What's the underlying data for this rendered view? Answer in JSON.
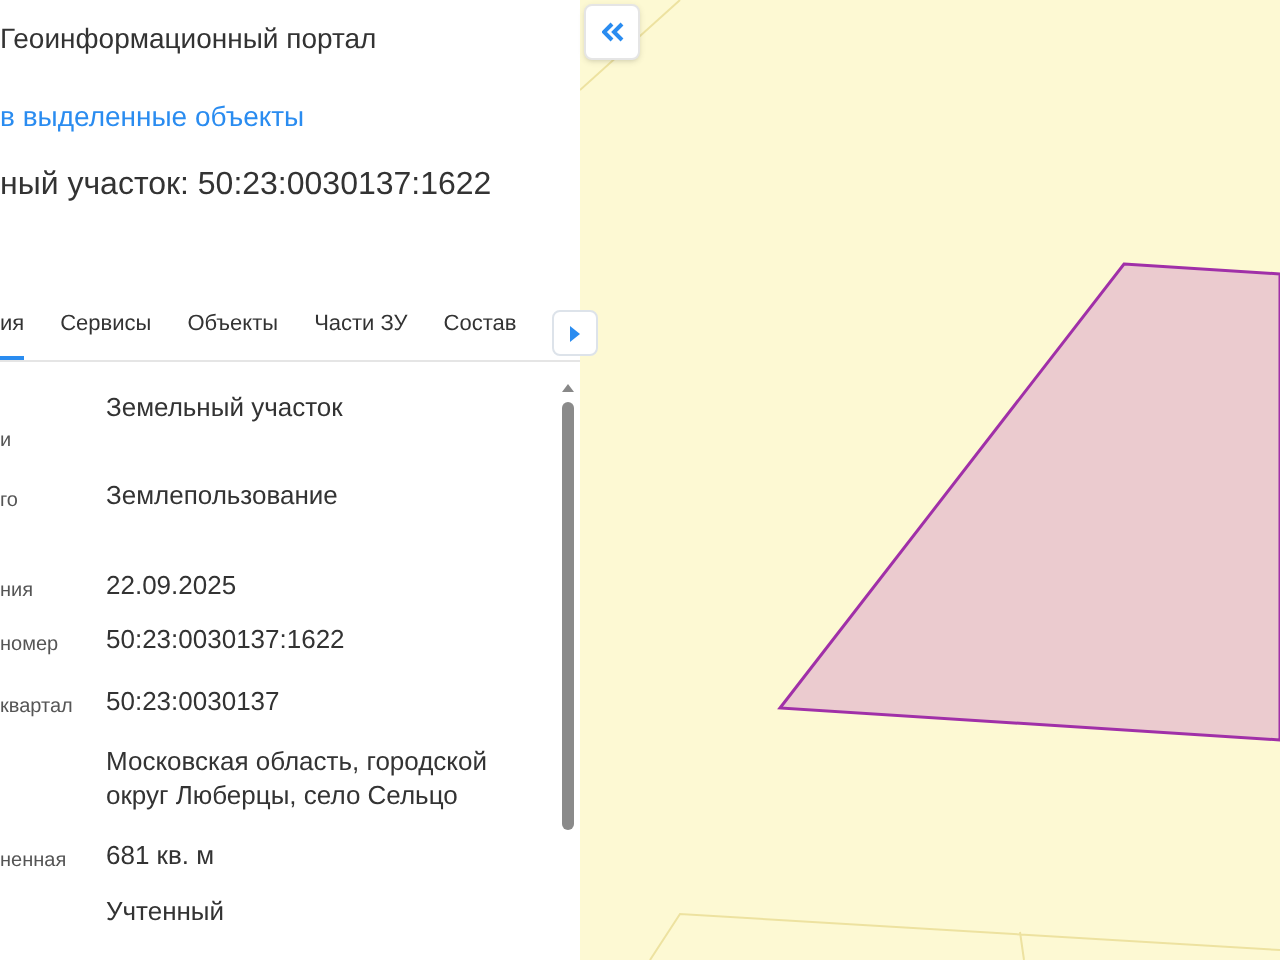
{
  "header": {
    "title": "Геоинформационный портал",
    "link": "в выделенные объекты",
    "heading": "ный участок: 50:23:0030137:1622"
  },
  "tabs": [
    {
      "label": "ия",
      "selected": true
    },
    {
      "label": "Сервисы",
      "selected": false
    },
    {
      "label": "Объекты",
      "selected": false
    },
    {
      "label": "Части ЗУ",
      "selected": false
    },
    {
      "label": "Состав",
      "selected": false
    }
  ],
  "fields": [
    {
      "label": "и",
      "value": "Земельный участок"
    },
    {
      "label": "го",
      "value": "Землепользование"
    },
    {
      "label": "ния",
      "value": "22.09.2025"
    },
    {
      "label": "номер",
      "value": "50:23:0030137:1622"
    },
    {
      "label": "квартал",
      "value": "50:23:0030137"
    },
    {
      "value": "Московская область, городской округ Люберцы, село Сельцо"
    },
    {
      "label": "ненная",
      "value": "681 кв. м"
    },
    {
      "value": "Учтенный"
    }
  ]
}
